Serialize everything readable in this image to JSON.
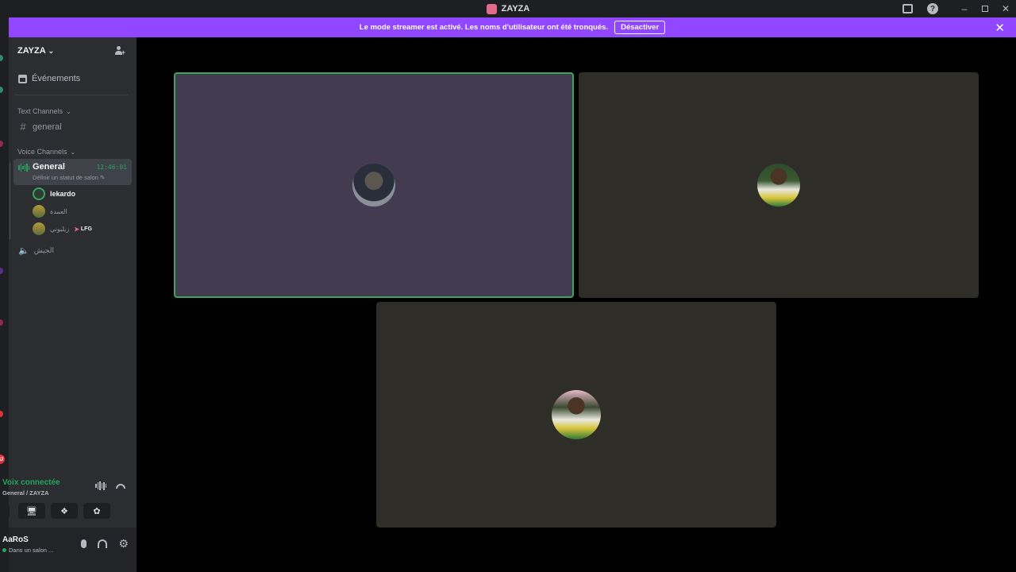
{
  "window": {
    "title": "ZAYZA"
  },
  "banner": {
    "message": "Le mode streamer est activé. Les noms d'utilisateur ont été tronqués.",
    "button_label": "Désactiver",
    "close_glyph": "✕"
  },
  "server": {
    "name": "ZAYZA",
    "events_label": "Événements"
  },
  "text_channels": {
    "category_label": "Text Channels",
    "channels": [
      "general"
    ]
  },
  "voice_channels": {
    "category_label": "Voice Channels",
    "active": {
      "name": "General",
      "timer": "12:46:01",
      "status_hint": "Définir un statut de salon ✎"
    },
    "members": [
      {
        "name": "lekardo",
        "tag": ""
      },
      {
        "name": "العمدة",
        "tag": ""
      },
      {
        "name": "زيلبوني",
        "tag": "LFG"
      }
    ],
    "other_channel": "الجيش"
  },
  "voice_connection": {
    "status": "Voix connectée",
    "location": "General / ZAYZA"
  },
  "user": {
    "name": "AaRoS",
    "status": "Dans un salon ..."
  },
  "rail": {
    "badge": "U"
  },
  "colors": {
    "banner": "#9146ff",
    "connected_green": "#23a55a",
    "speaking_border": "#3ba55d",
    "tile_purple": "#433b4f",
    "tile_dark": "#2e2d28"
  },
  "icons": {
    "app": "discord-app-icon",
    "inbox": "inbox-icon",
    "help": "help-icon",
    "invite": "invite-people-icon",
    "events": "calendar-icon",
    "text": "hash-icon",
    "voice": "speaker-icon",
    "mic": "microphone-icon",
    "headset": "headset-icon",
    "settings": "gear-icon"
  }
}
